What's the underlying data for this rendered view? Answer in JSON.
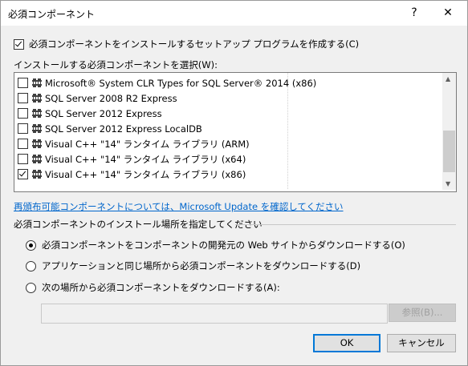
{
  "window": {
    "title": "必須コンポーネント",
    "help_label": "?",
    "close_label": "✕"
  },
  "create_setup": {
    "label": "必須コンポーネントをインストールするセットアップ プログラムを作成する(C)",
    "checked": true
  },
  "select_label": "インストールする必須コンポーネントを選択(W):",
  "components": [
    {
      "label": "Microsoft® System CLR Types for SQL Server® 2014 (x86)",
      "checked": false
    },
    {
      "label": "SQL Server 2008 R2 Express",
      "checked": false
    },
    {
      "label": "SQL Server 2012 Express",
      "checked": false
    },
    {
      "label": "SQL Server 2012 Express LocalDB",
      "checked": false
    },
    {
      "label": "Visual C++ \"14\" ランタイム ライブラリ (ARM)",
      "checked": false
    },
    {
      "label": "Visual C++ \"14\" ランタイム ライブラリ (x64)",
      "checked": false
    },
    {
      "label": "Visual C++ \"14\" ランタイム ライブラリ (x86)",
      "checked": true
    }
  ],
  "redistributable_link": "再頒布可能コンポーネントについては、Microsoft Update を確認してください",
  "location_group_label": "必須コンポーネントのインストール場所を指定してください",
  "location_options": [
    {
      "label": "必須コンポーネントをコンポーネントの開発元の Web サイトからダウンロードする(O)",
      "selected": true
    },
    {
      "label": "アプリケーションと同じ場所から必須コンポーネントをダウンロードする(D)",
      "selected": false
    },
    {
      "label": "次の場所から必須コンポーネントをダウンロードする(A):",
      "selected": false
    }
  ],
  "download_path": {
    "value": ""
  },
  "browse_label": "参照(B)...",
  "ok_label": "OK",
  "cancel_label": "キャンセル"
}
